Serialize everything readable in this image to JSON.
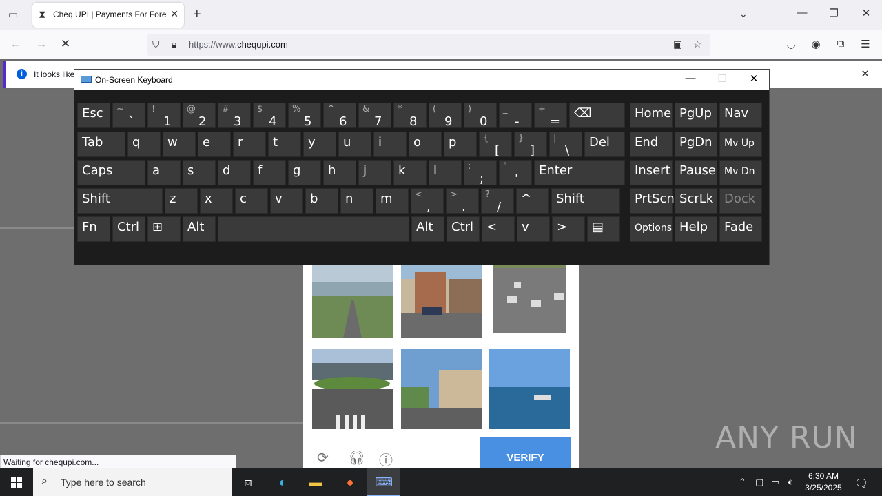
{
  "browser": {
    "tab_title": "Cheq UPI | Payments For Foreig",
    "new_tab": "+",
    "url_prefix": "https://www.",
    "url_domain": "chequpi.com",
    "notification_text": "It looks like",
    "status_text": "Waiting for chequpi.com..."
  },
  "osk": {
    "title": "On-Screen Keyboard",
    "rows": [
      [
        {
          "main": "Esc"
        },
        {
          "sec": "~",
          "pri": "`"
        },
        {
          "sec": "!",
          "pri": "1"
        },
        {
          "sec": "@",
          "pri": "2"
        },
        {
          "sec": "#",
          "pri": "3"
        },
        {
          "sec": "$",
          "pri": "4"
        },
        {
          "sec": "%",
          "pri": "5"
        },
        {
          "sec": "^",
          "pri": "6"
        },
        {
          "sec": "&",
          "pri": "7"
        },
        {
          "sec": "*",
          "pri": "8"
        },
        {
          "sec": "(",
          "pri": "9"
        },
        {
          "sec": ")",
          "pri": "0"
        },
        {
          "sec": "_",
          "pri": "-"
        },
        {
          "sec": "+",
          "pri": "="
        },
        {
          "main": "⌫"
        },
        {
          "main": "Home"
        },
        {
          "main": "PgUp"
        },
        {
          "main": "Nav"
        }
      ],
      [
        {
          "main": "Tab"
        },
        {
          "main": "q"
        },
        {
          "main": "w"
        },
        {
          "main": "e"
        },
        {
          "main": "r"
        },
        {
          "main": "t"
        },
        {
          "main": "y"
        },
        {
          "main": "u"
        },
        {
          "main": "i"
        },
        {
          "main": "o"
        },
        {
          "main": "p"
        },
        {
          "sec": "{",
          "pri": "["
        },
        {
          "sec": "}",
          "pri": "]"
        },
        {
          "sec": "|",
          "pri": "\\"
        },
        {
          "main": "Del"
        },
        {
          "main": "End"
        },
        {
          "main": "PgDn"
        },
        {
          "main": "Mv Up"
        }
      ],
      [
        {
          "main": "Caps"
        },
        {
          "main": "a"
        },
        {
          "main": "s"
        },
        {
          "main": "d"
        },
        {
          "main": "f"
        },
        {
          "main": "g"
        },
        {
          "main": "h"
        },
        {
          "main": "j"
        },
        {
          "main": "k"
        },
        {
          "main": "l"
        },
        {
          "sec": ":",
          "pri": ";"
        },
        {
          "sec": "\"",
          "pri": "'"
        },
        {
          "main": "Enter"
        },
        {
          "main": "Insert"
        },
        {
          "main": "Pause"
        },
        {
          "main": "Mv Dn"
        }
      ],
      [
        {
          "main": "Shift"
        },
        {
          "main": "z"
        },
        {
          "main": "x"
        },
        {
          "main": "c"
        },
        {
          "main": "v"
        },
        {
          "main": "b"
        },
        {
          "main": "n"
        },
        {
          "main": "m"
        },
        {
          "sec": "<",
          "pri": ","
        },
        {
          "sec": ">",
          "pri": "."
        },
        {
          "sec": "?",
          "pri": "/"
        },
        {
          "main": "^"
        },
        {
          "main": "Shift"
        },
        {
          "main": "PrtScn"
        },
        {
          "main": "ScrLk"
        },
        {
          "main": "Dock"
        }
      ],
      [
        {
          "main": "Fn"
        },
        {
          "main": "Ctrl"
        },
        {
          "main": "⊞"
        },
        {
          "main": "Alt"
        },
        {
          "main": ""
        },
        {
          "main": "Alt"
        },
        {
          "main": "Ctrl"
        },
        {
          "main": "<"
        },
        {
          "main": "v"
        },
        {
          "main": ">"
        },
        {
          "main": "▤"
        },
        {
          "main": "Options"
        },
        {
          "main": "Help"
        },
        {
          "main": "Fade"
        }
      ]
    ]
  },
  "captcha": {
    "verify_label": "VERIFY"
  },
  "taskbar": {
    "search_placeholder": "Type here to search",
    "time": "6:30 AM",
    "date": "3/25/2025"
  },
  "watermark": "ANY RUN"
}
